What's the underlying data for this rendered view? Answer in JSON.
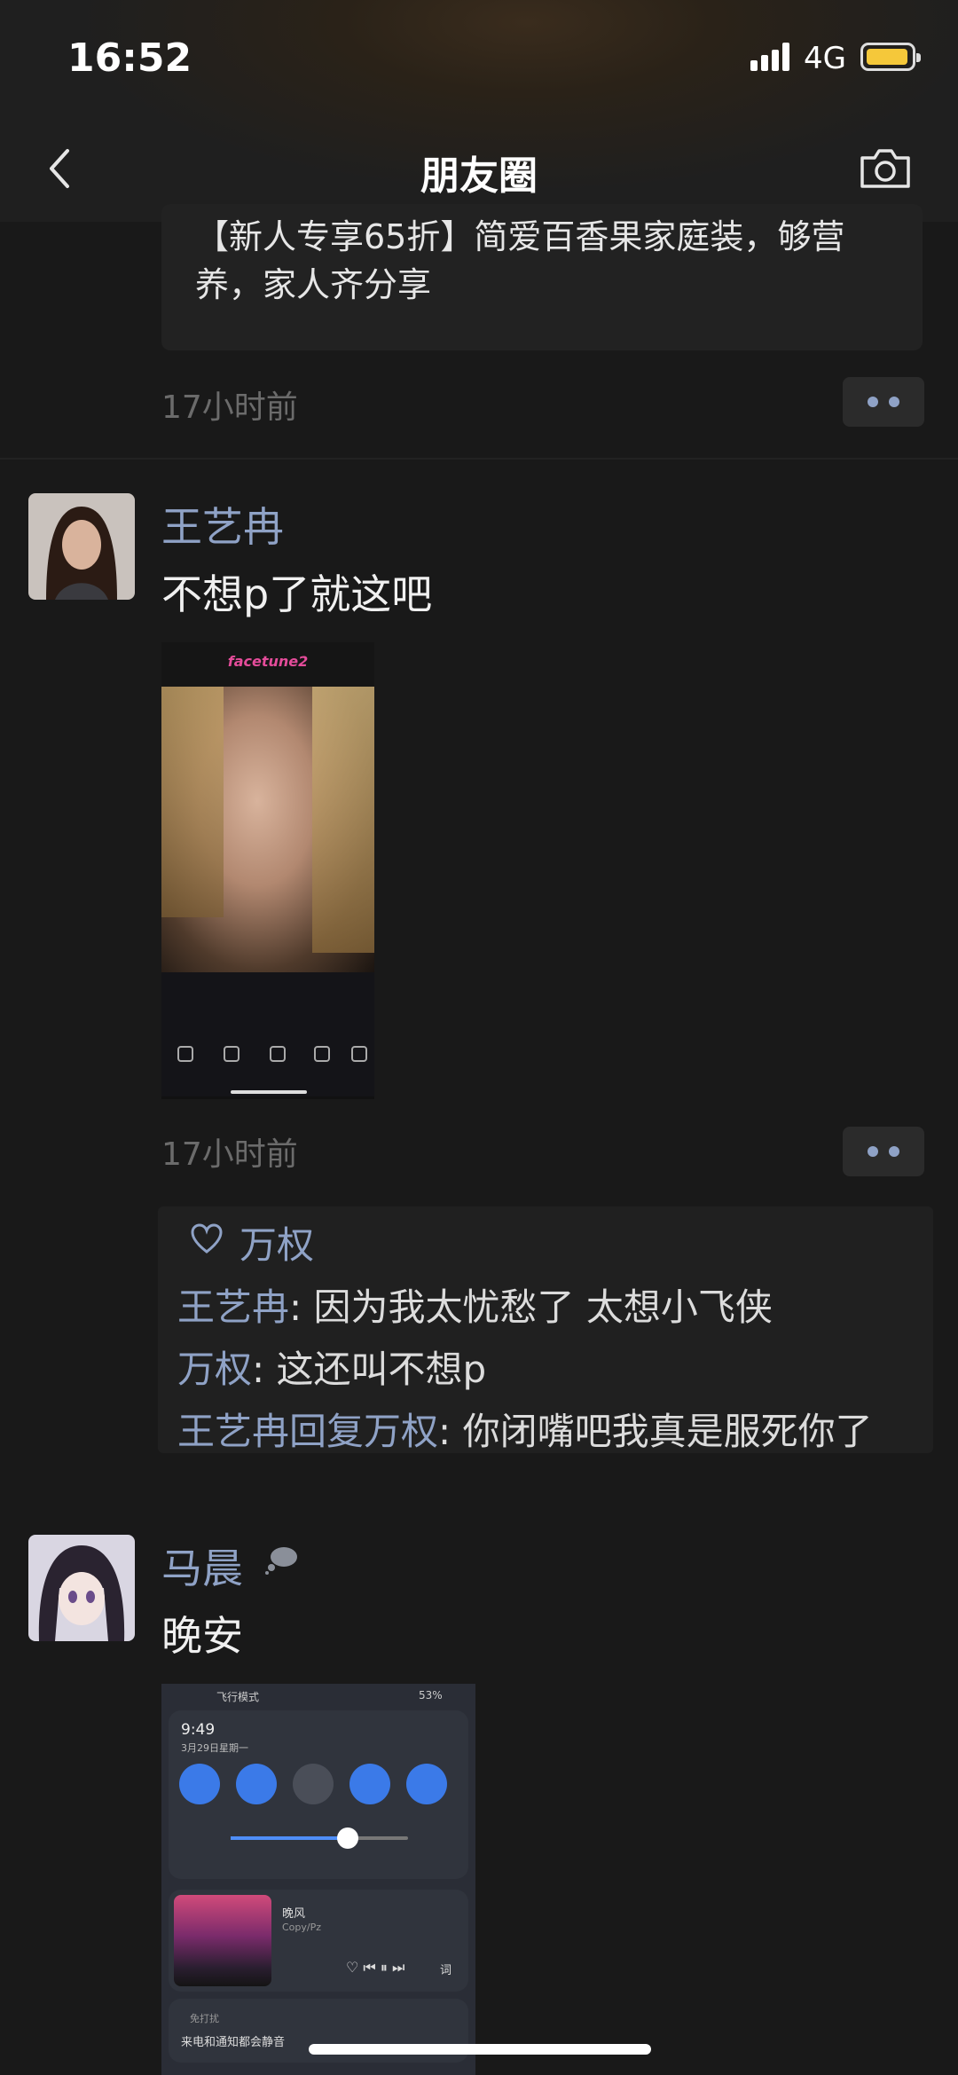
{
  "status_bar": {
    "time": "16:52",
    "network": "4G"
  },
  "nav": {
    "title": "朋友圈"
  },
  "posts": [
    {
      "text": "【新人专享65折】简爱百香果家庭装，够营养，家人齐分享",
      "time": "17小时前"
    },
    {
      "author": "王艺冉",
      "text": "不想p了就这吧",
      "photo_app_logo": "facetune2",
      "time": "17小时前",
      "likes": [
        "万权"
      ],
      "comments": [
        {
          "user": "王艺冉",
          "text": "因为我太忧愁了 太想小飞侠"
        },
        {
          "user": "万权",
          "text": "这还叫不想p"
        },
        {
          "user": "王艺冉",
          "reply_word": "回复",
          "reply_to": "万权",
          "text": "你闭嘴吧我真是服死你了"
        }
      ]
    },
    {
      "author": "马晨",
      "text": "晚安",
      "photo": {
        "status": "飞行模式",
        "battery": "53%",
        "clock": "9:49",
        "date": "3月29日星期一",
        "song": "晚风",
        "artist": "Copy/Pz",
        "lyrics_btn": "词",
        "dnd_title": "免打扰",
        "dnd_desc": "来电和通知都会静音"
      }
    }
  ],
  "colors": {
    "link": "#8fa2c6",
    "background": "#191919",
    "accent_blue": "#3b7ae8"
  }
}
